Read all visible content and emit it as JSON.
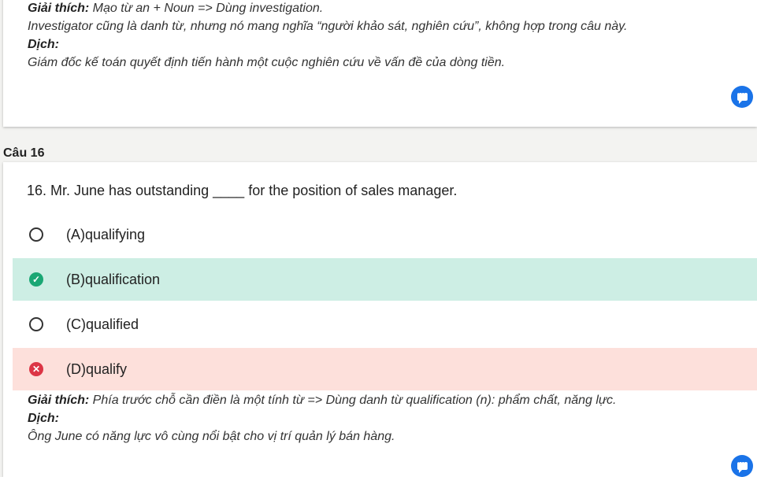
{
  "prev": {
    "explain_label": "Giải thích:",
    "explain_text": " Mạo từ an + Noun => Dùng investigation.",
    "explain_line2": "Investigator cũng là danh từ, nhưng nó mang nghĩa “người khảo sát, nghiên cứu”, không hợp trong câu này.",
    "translate_label": "Dịch:",
    "translate_text": "Giám đốc kế toán quyết định tiến hành một cuộc nghiên cứu về vấn đề của dòng tiền."
  },
  "question": {
    "label": "Câu 16",
    "text": "16. Mr. June has outstanding ____ for the position of sales manager.",
    "options": [
      {
        "label": "(A)qualifying",
        "state": "unselected"
      },
      {
        "label": "(B)qualification",
        "state": "correct"
      },
      {
        "label": "(C)qualified",
        "state": "unselected"
      },
      {
        "label": "(D)qualify",
        "state": "wrong"
      }
    ],
    "explain_label": "Giải thích:",
    "explain_text": " Phía trước chỗ cần điền là một tính từ => Dùng danh từ qualification (n): phẩm chất, năng lực.",
    "translate_label": "Dịch:",
    "translate_text": "Ông June có năng lực vô cùng nổi bật cho vị trí quản lý bán hàng."
  },
  "colors": {
    "correct_bg": "#cdeee4",
    "wrong_bg": "#fde0db",
    "accent": "#1a73e8"
  }
}
